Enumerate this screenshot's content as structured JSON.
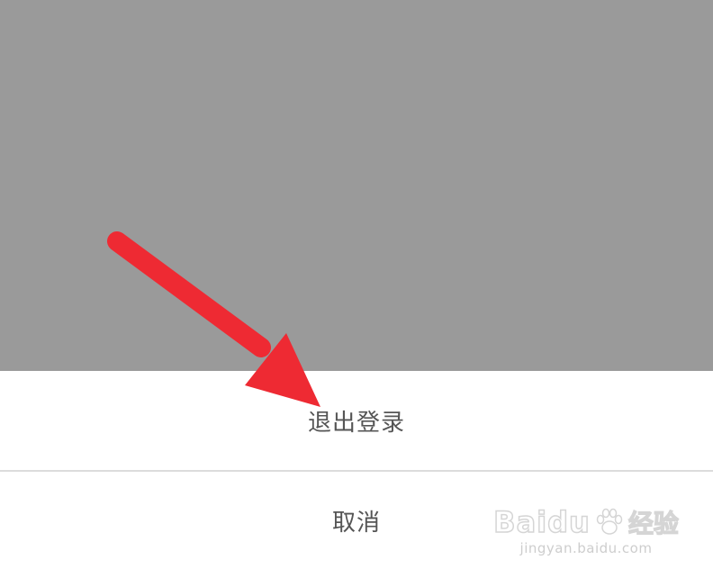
{
  "action_sheet": {
    "logout_label": "退出登录",
    "cancel_label": "取消"
  },
  "annotation": {
    "arrow_color": "#ee2a33",
    "arrow_icon": "red-arrow-icon"
  },
  "watermark": {
    "brand": "Baidu",
    "product": "经验",
    "url": "jingyan.baidu.com",
    "icon": "paw-icon"
  },
  "colors": {
    "overlay": "#9a9a9a",
    "sheet_background": "#ffffff",
    "option_text": "#555555",
    "divider": "#dcdcdc"
  }
}
